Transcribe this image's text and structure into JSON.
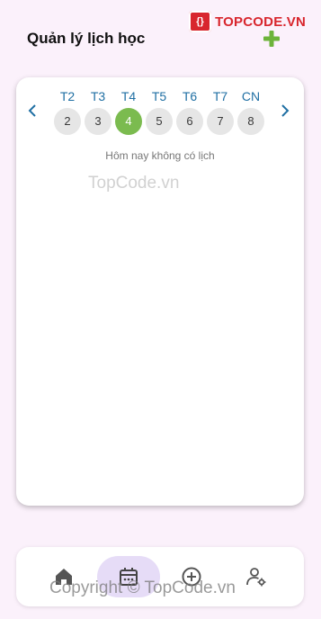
{
  "header": {
    "title": "Quản lý lịch học"
  },
  "brand": {
    "mark": "{}",
    "text": "TOPCODE.VN"
  },
  "colors": {
    "accent": "#7bbb4f",
    "day_label": "#1f6fa3",
    "brand": "#d8262d",
    "nav_active": "#e6dcf7"
  },
  "week": {
    "days": [
      {
        "label": "T2",
        "num": "2"
      },
      {
        "label": "T3",
        "num": "3"
      },
      {
        "label": "T4",
        "num": "4"
      },
      {
        "label": "T5",
        "num": "5"
      },
      {
        "label": "T6",
        "num": "6"
      },
      {
        "label": "T7",
        "num": "7"
      },
      {
        "label": "CN",
        "num": "8"
      }
    ],
    "selected": "4"
  },
  "schedule": {
    "empty_message": "Hôm nay không có lịch"
  },
  "nav": {
    "items": [
      {
        "icon": "home-icon"
      },
      {
        "icon": "calendar-icon"
      },
      {
        "icon": "add-circle-icon"
      },
      {
        "icon": "user-settings-icon"
      }
    ]
  },
  "watermarks": {
    "center": "TopCode.vn",
    "bottom": "Copyright © TopCode.vn"
  }
}
